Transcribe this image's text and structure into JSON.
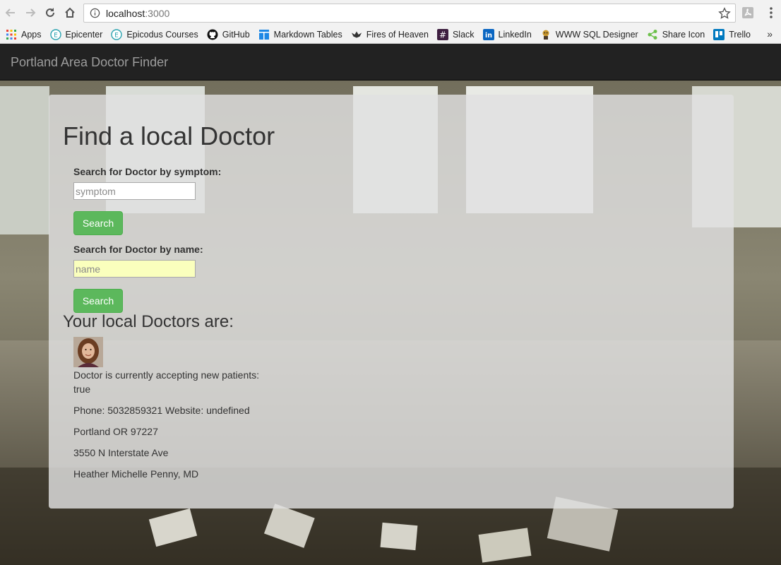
{
  "browser": {
    "url_host": "localhost",
    "url_path": ":3000",
    "bookmarks": [
      {
        "label": "Apps",
        "icon": "apps-grid-icon"
      },
      {
        "label": "Epicenter",
        "icon": "epicodus-icon"
      },
      {
        "label": "Epicodus Courses",
        "icon": "epicodus-icon"
      },
      {
        "label": "GitHub",
        "icon": "github-icon"
      },
      {
        "label": "Markdown Tables",
        "icon": "table-icon"
      },
      {
        "label": "Fires of Heaven",
        "icon": "bird-icon"
      },
      {
        "label": "Slack",
        "icon": "slack-icon"
      },
      {
        "label": "LinkedIn",
        "icon": "linkedin-icon"
      },
      {
        "label": "WWW SQL Designer",
        "icon": "sql-designer-icon"
      },
      {
        "label": "Share Icon",
        "icon": "share-icon"
      },
      {
        "label": "Trello",
        "icon": "trello-icon"
      }
    ],
    "more_label": "»"
  },
  "navbar": {
    "brand": "Portland Area Doctor Finder"
  },
  "main": {
    "title": "Find a local Doctor",
    "symptom_label": "Search for Doctor by symptom:",
    "symptom_placeholder": "symptom",
    "symptom_button": "Search",
    "name_label": "Search for Doctor by name:",
    "name_placeholder": "name",
    "name_button": "Search",
    "results_title": "Your local Doctors are:"
  },
  "doctor": {
    "accepting_line1": "Doctor is currently accepting new patients:",
    "accepting_value": "true",
    "contact": "Phone: 5032859321 Website: undefined",
    "city": "Portland OR 97227",
    "street": "3550 N Interstate Ave",
    "name": "Heather Michelle Penny, MD"
  },
  "colors": {
    "navbar": "#222222",
    "brand_text": "#9d9d9d",
    "button": "#5cb85c",
    "autofill": "#faffbd"
  }
}
